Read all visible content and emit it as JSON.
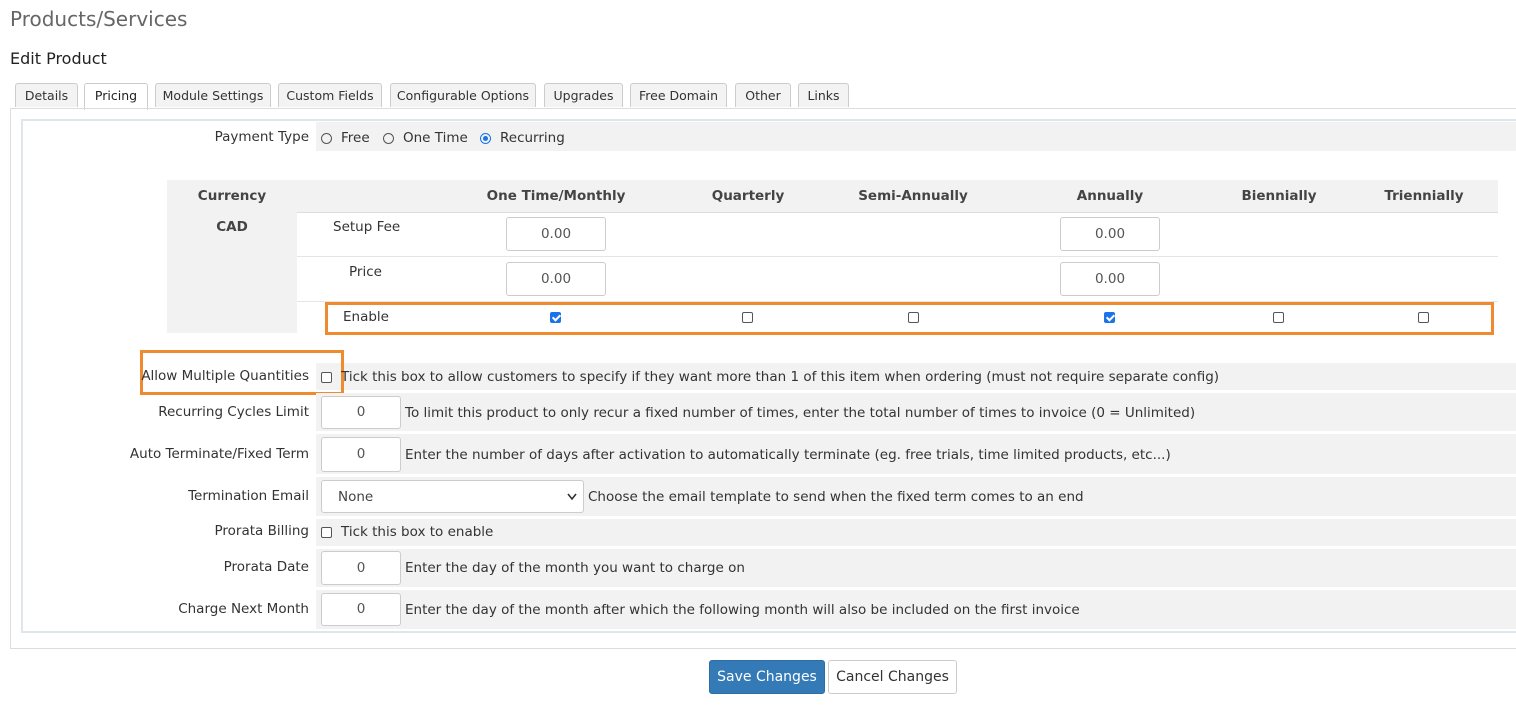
{
  "header": {
    "title": "Products/Services",
    "subtitle": "Edit Product"
  },
  "tabs": [
    "Details",
    "Pricing",
    "Module Settings",
    "Custom Fields",
    "Configurable Options",
    "Upgrades",
    "Free Domain",
    "Other",
    "Links"
  ],
  "active_tab": "Pricing",
  "payment_type": {
    "label": "Payment Type",
    "options": [
      "Free",
      "One Time",
      "Recurring"
    ],
    "selected": "Recurring"
  },
  "pricing_table": {
    "headers": [
      "Currency",
      "One Time/Monthly",
      "Quarterly",
      "Semi-Annually",
      "Annually",
      "Biennially",
      "Triennially"
    ],
    "currency": "CAD",
    "row_labels": {
      "setup_fee": "Setup Fee",
      "price": "Price",
      "enable": "Enable"
    },
    "setup_fee": {
      "monthly": "0.00",
      "annually": "0.00"
    },
    "price": {
      "monthly": "0.00",
      "annually": "0.00"
    },
    "enable": [
      true,
      false,
      false,
      true,
      false,
      false
    ]
  },
  "fields": {
    "allow_multiple": {
      "label": "Allow Multiple Quantities",
      "checked": false,
      "help": "Tick this box to allow customers to specify if they want more than 1 of this item when ordering (must not require separate config)"
    },
    "recurring_cycles": {
      "label": "Recurring Cycles Limit",
      "value": "0",
      "help": "To limit this product to only recur a fixed number of times, enter the total number of times to invoice (0 = Unlimited)"
    },
    "auto_terminate": {
      "label": "Auto Terminate/Fixed Term",
      "value": "0",
      "help": "Enter the number of days after activation to automatically terminate (eg. free trials, time limited products, etc...)"
    },
    "termination_email": {
      "label": "Termination Email",
      "value": "None",
      "help": "Choose the email template to send when the fixed term comes to an end"
    },
    "prorata_billing": {
      "label": "Prorata Billing",
      "checked": false,
      "help": "Tick this box to enable"
    },
    "prorata_date": {
      "label": "Prorata Date",
      "value": "0",
      "help": "Enter the day of the month you want to charge on"
    },
    "charge_next_month": {
      "label": "Charge Next Month",
      "value": "0",
      "help": "Enter the day of the month after which the following month will also be included on the first invoice"
    }
  },
  "buttons": {
    "save": "Save Changes",
    "cancel": "Cancel Changes"
  },
  "colors": {
    "highlight": "#f08a2e",
    "primary": "#337ab7",
    "check": "#1a73e8"
  }
}
